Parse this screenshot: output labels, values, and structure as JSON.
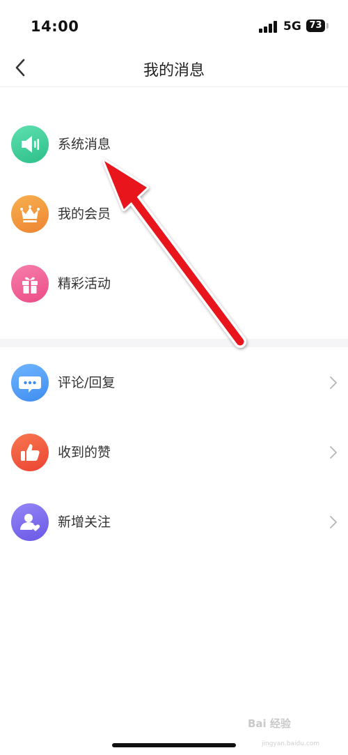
{
  "status_bar": {
    "time": "14:00",
    "network": "5G",
    "battery": "73"
  },
  "nav": {
    "title": "我的消息",
    "back_icon": "chevron-left-icon"
  },
  "section_primary": {
    "items": [
      {
        "label": "系统消息",
        "icon": "speaker-icon",
        "color": "#3ecf9a"
      },
      {
        "label": "我的会员",
        "icon": "crown-icon",
        "color": "#f39a3c"
      },
      {
        "label": "精彩活动",
        "icon": "gift-icon",
        "color": "#f15f95"
      }
    ]
  },
  "section_secondary": {
    "items": [
      {
        "label": "评论/回复",
        "icon": "chat-bubble-icon",
        "color": "#4c9cf5"
      },
      {
        "label": "收到的赞",
        "icon": "thumbs-up-icon",
        "color": "#f0553e"
      },
      {
        "label": "新增关注",
        "icon": "new-follower-icon",
        "color": "#7d6df0"
      }
    ]
  },
  "annotation": {
    "arrow_color": "#e8161f"
  },
  "watermark": {
    "text": "Bai 经验",
    "sub": "jingyan.baidu.com"
  }
}
